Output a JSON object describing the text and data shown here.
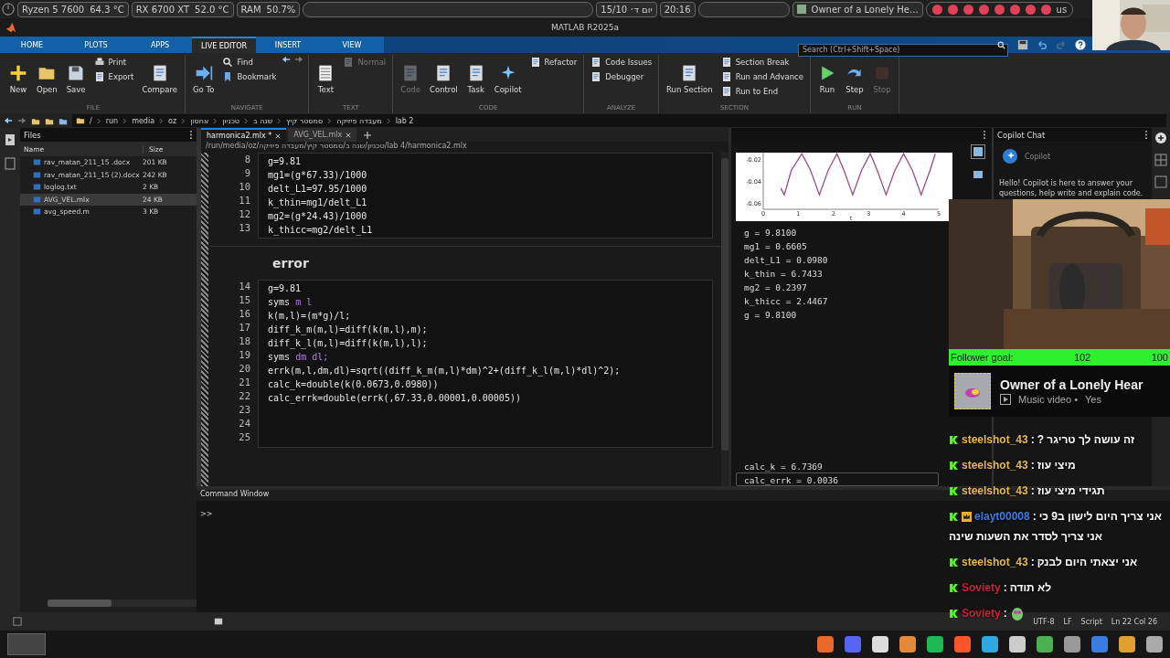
{
  "system_bar": {
    "cpu": "Ryzen 5 7600",
    "cpu_temp": "64.3 °C",
    "gpu": "RX 6700 XT",
    "gpu_temp": "52.0 °C",
    "ram_label": "RAM",
    "ram_value": "50.7%",
    "date": "15/10 יום ד׳",
    "time": "20:16",
    "media": "Owner of a Lonely He...",
    "keyboard": "us"
  },
  "window": {
    "title": "MATLAB R2025a"
  },
  "tabs": [
    {
      "label": "HOME",
      "selected": false
    },
    {
      "label": "PLOTS",
      "selected": false
    },
    {
      "label": "APPS",
      "selected": false
    },
    {
      "label": "LIVE EDITOR",
      "selected": true
    },
    {
      "label": "INSERT",
      "selected": false
    },
    {
      "label": "VIEW",
      "selected": false
    }
  ],
  "search": {
    "placeholder": "Search (Ctrl+Shift+Space)"
  },
  "toolstrip": [
    {
      "title": "FILE",
      "buttons": [
        {
          "label": "New",
          "kind": "large",
          "disabled": false
        },
        {
          "label": "Open",
          "kind": "large",
          "disabled": false
        },
        {
          "label": "Save",
          "kind": "large",
          "disabled": false
        },
        {
          "label": "Print",
          "kind": "small",
          "disabled": false
        },
        {
          "label": "Export",
          "kind": "small",
          "disabled": false
        },
        {
          "label": "Compare",
          "kind": "large",
          "disabled": false
        }
      ]
    },
    {
      "title": "NAVIGATE",
      "buttons": [
        {
          "label": "Go To",
          "kind": "large",
          "disabled": false
        },
        {
          "label": "Find",
          "kind": "small",
          "disabled": false
        },
        {
          "label": "Bookmark",
          "kind": "small",
          "disabled": false
        }
      ]
    },
    {
      "title": "TEXT",
      "buttons": [
        {
          "label": "Text",
          "kind": "large",
          "disabled": false
        },
        {
          "label": "Normal",
          "kind": "small",
          "disabled": true
        }
      ]
    },
    {
      "title": "CODE",
      "buttons": [
        {
          "label": "Code",
          "kind": "large",
          "disabled": true
        },
        {
          "label": "Control",
          "kind": "large",
          "disabled": false
        },
        {
          "label": "Task",
          "kind": "large",
          "disabled": false
        },
        {
          "label": "Copilot",
          "kind": "large",
          "disabled": false
        },
        {
          "label": "Refactor",
          "kind": "small",
          "disabled": false
        }
      ]
    },
    {
      "title": "ANALYZE",
      "buttons": [
        {
          "label": "Code Issues",
          "kind": "small",
          "disabled": false
        },
        {
          "label": "Debugger",
          "kind": "small",
          "disabled": false
        }
      ]
    },
    {
      "title": "SECTION",
      "buttons": [
        {
          "label": "Run Section",
          "kind": "large",
          "disabled": false
        },
        {
          "label": "Section Break",
          "kind": "small",
          "disabled": false
        },
        {
          "label": "Run and Advance",
          "kind": "small",
          "disabled": false
        },
        {
          "label": "Run to End",
          "kind": "small",
          "disabled": false
        }
      ]
    },
    {
      "title": "RUN",
      "buttons": [
        {
          "label": "Run",
          "kind": "large",
          "disabled": false
        },
        {
          "label": "Step",
          "kind": "large",
          "disabled": false
        },
        {
          "label": "Stop",
          "kind": "large",
          "disabled": true
        }
      ]
    }
  ],
  "breadcrumb": [
    "/",
    "run",
    "media",
    "oz",
    "אחסון",
    "טכניון",
    "שנה ב",
    "סמסטר קיץ",
    "מעבדה פיזיקה",
    "lab 2"
  ],
  "files": {
    "title": "Files",
    "columns": [
      "Name",
      "Size"
    ],
    "rows": [
      {
        "name": "rav_matan_211_15 .docx",
        "size": "201 KB",
        "selected": false
      },
      {
        "name": "rav_matan_211_15 (2).docx",
        "size": "242 KB",
        "selected": false
      },
      {
        "name": "loglog.txt",
        "size": "2 KB",
        "selected": false
      },
      {
        "name": "AVG_VEL.mlx",
        "size": "24 KB",
        "selected": true
      },
      {
        "name": "avg_speed.m",
        "size": "3 KB",
        "selected": false
      }
    ]
  },
  "editor": {
    "tabs": [
      {
        "label": "harmonica2.mlx *",
        "selected": true
      },
      {
        "label": "AVG_VEL.mlx",
        "selected": false
      }
    ],
    "path": "/run/media/oz/טכניון/שנה ב/סמסטר קיץ/מעבדה פיזיקה/lab 4/harmonica2.mlx",
    "sections": [
      {
        "lines": [
          {
            "number": "8",
            "text": "g=9.81"
          },
          {
            "number": "9",
            "text": "mg1=(g*67.33)/1000"
          },
          {
            "number": "10",
            "text": "delt_L1=97.95/1000"
          },
          {
            "number": "11",
            "text": "k_thin=mg1/delt_L1"
          },
          {
            "number": "12",
            "text": "mg2=(g*24.43)/1000"
          },
          {
            "number": "13",
            "text": "k_thicc=mg2/delt_L1"
          }
        ]
      },
      {
        "heading": "error",
        "lines": [
          {
            "number": "14",
            "text": "g=9.81"
          },
          {
            "number": "15",
            "text": "syms",
            "args": "m l"
          },
          {
            "number": "16",
            "text": "k(m,l)=(m*g)/l;"
          },
          {
            "number": "17",
            "text": "diff_k_m(m,l)=diff(k(m,l),m);"
          },
          {
            "number": "18",
            "text": "diff_k_l(m,l)=diff(k(m,l),l);"
          },
          {
            "number": "19",
            "text": "syms",
            "args": "dm dl;"
          },
          {
            "number": "20",
            "text": "errk(m,l,dm,dl)=sqrt((diff_k_m(m,l)*dm)^2+(diff_k_l(m,l)*dl)^2);"
          },
          {
            "number": "21",
            "text": "calc_k=double(k(0.0673,0.0980))"
          },
          {
            "number": "22",
            "text": "calc_errk=double(errk(,67.33,0.00001,0.00005))"
          },
          {
            "number": "23"
          },
          {
            "number": "24"
          },
          {
            "number": "25"
          }
        ]
      }
    ]
  },
  "output": {
    "chart_data": {
      "type": "line",
      "xlabel": "t",
      "xlim": [
        0,
        5
      ],
      "ylim": [
        -0.065,
        -0.014
      ],
      "xticks": [
        0,
        1,
        2,
        3,
        4,
        5
      ],
      "yticks": [
        -0.06,
        -0.04,
        -0.02
      ],
      "x": [
        0.5,
        0.6,
        0.8,
        1.1,
        1.35,
        1.6,
        1.85,
        2.1,
        2.3,
        2.55,
        2.8,
        3.05,
        3.25,
        3.5,
        3.75,
        4.0,
        4.25,
        4.5,
        4.75,
        4.9
      ],
      "series": [
        {
          "color": "#9a4a8a",
          "values": [
            -0.046,
            -0.052,
            -0.03,
            -0.015,
            -0.03,
            -0.052,
            -0.03,
            -0.015,
            -0.03,
            -0.052,
            -0.03,
            -0.015,
            -0.03,
            -0.052,
            -0.03,
            -0.015,
            -0.03,
            -0.052,
            -0.03,
            -0.015
          ]
        }
      ]
    },
    "values": [
      {
        "text": "g = 9.8100",
        "selected": false
      },
      {
        "text": "mg1 = 0.6605",
        "selected": false
      },
      {
        "text": "delt_L1 = 0.0980",
        "selected": false
      },
      {
        "text": "k_thin = 6.7433",
        "selected": false
      },
      {
        "text": "mg2 = 0.2397",
        "selected": false
      },
      {
        "text": "k_thicc = 2.4467",
        "selected": false
      },
      {
        "text": "g = 9.8100",
        "selected": false
      }
    ],
    "results": [
      {
        "text": "calc_k = 6.7369",
        "selected": false
      },
      {
        "text": "calc_errk = 0.0036",
        "selected": true
      }
    ]
  },
  "copilot": {
    "title": "Copilot Chat",
    "name": "Copilot",
    "greeting": "Hello! Copilot is here to answer your questions, help write and explain code."
  },
  "command_window": {
    "title": "Command Window",
    "prompt": ">>"
  },
  "status_bar": [
    "UTF-8",
    "LF",
    "Script",
    "Ln 22 Col 26"
  ],
  "follower_goal": {
    "label": "Follower goal:",
    "current": "102",
    "target": "100"
  },
  "now_playing": {
    "title": "Owner of a Lonely Hear",
    "subtitle": "Music video •",
    "artist": "Yes"
  },
  "chat": [
    {
      "kind": "text",
      "user": "steelshot_43",
      "separator": ":",
      "color": "#e8b84a",
      "badge": false,
      "text": "זה עושה לך טריגר ?"
    },
    {
      "kind": "text",
      "user": "steelshot_43",
      "separator": ":",
      "color": "#e8b84a",
      "badge": false,
      "text": "מיצי עוז"
    },
    {
      "kind": "text",
      "user": "steelshot_43",
      "separator": ":",
      "color": "#e8b84a",
      "badge": false,
      "text": "תגידי מיצי עוז"
    },
    {
      "kind": "text",
      "user": "elayt00008",
      "separator": ":",
      "color": "#3a7de0",
      "badge": true,
      "text": "אני צריך היום לישון ב9 כי"
    },
    {
      "kind": "continuation",
      "text": "אני צריך לסדר את השעות שינה"
    },
    {
      "kind": "text",
      "user": "steelshot_43",
      "separator": ":",
      "color": "#e8b84a",
      "badge": false,
      "text": "אני יצאתי היום לבנק"
    },
    {
      "kind": "text",
      "user": "Soviety",
      "separator": ":",
      "color": "#c8203a",
      "badge": false,
      "text": "לא תודה"
    },
    {
      "kind": "emote",
      "user": "Soviety",
      "separator": ":",
      "color": "#c8203a",
      "badge": false
    }
  ]
}
